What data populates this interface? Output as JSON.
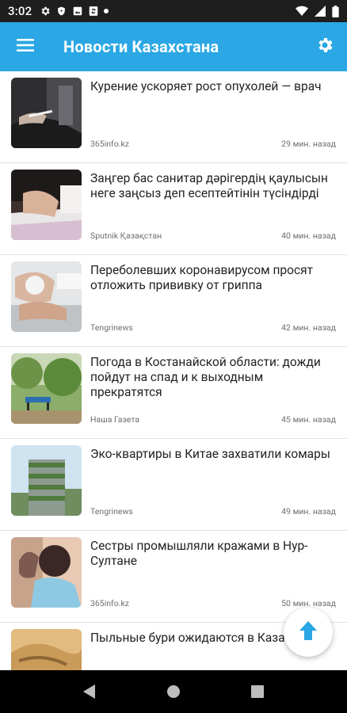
{
  "status_bar": {
    "time": "3:02",
    "icons": [
      "gear-icon",
      "shield-icon",
      "image-icon",
      "sync-icon",
      "dot-icon"
    ],
    "right_icons": [
      "wifi-icon",
      "signal-icon",
      "battery-icon"
    ]
  },
  "app_bar": {
    "title": "Новости Казахстана",
    "background": "#2aa7e4",
    "icons": [
      "menu-icon",
      "gear-icon"
    ]
  },
  "news": [
    {
      "headline": "Курение ускоряет рост опухолей — врач",
      "source": "365info.kz",
      "time": "29 мин. назад"
    },
    {
      "headline": "Заңгер бас санитар дәрігердің қаулысын неге заңсыз деп есептейтінін түсіндірді",
      "source": "Sputnik Қазақстан",
      "time": "40 мин. назад"
    },
    {
      "headline": "Переболевших коронавирусом просят отложить прививку от гриппа",
      "source": "Tengrinews",
      "time": "42 мин. назад"
    },
    {
      "headline": "Погода в Костанайской области: дожди пойдут на спад и к выходным прекратятся",
      "source": "Наша Газета",
      "time": "45 мин. назад"
    },
    {
      "headline": "Эко-квартиры в Китае захватили комары",
      "source": "Tengrinews",
      "time": "49 мин. назад"
    },
    {
      "headline": "Сестры промышляли кражами в Нур-Султане",
      "source": "365info.kz",
      "time": "50 мин. назад"
    },
    {
      "headline": "Пыльные бури ожидаются в Каза",
      "source": "",
      "time": ""
    }
  ],
  "fab": {
    "icon": "arrow-up-icon",
    "color": "#2aa7e4"
  },
  "nav_bar": {
    "icons": [
      "back-icon",
      "home-icon",
      "recents-icon"
    ]
  }
}
